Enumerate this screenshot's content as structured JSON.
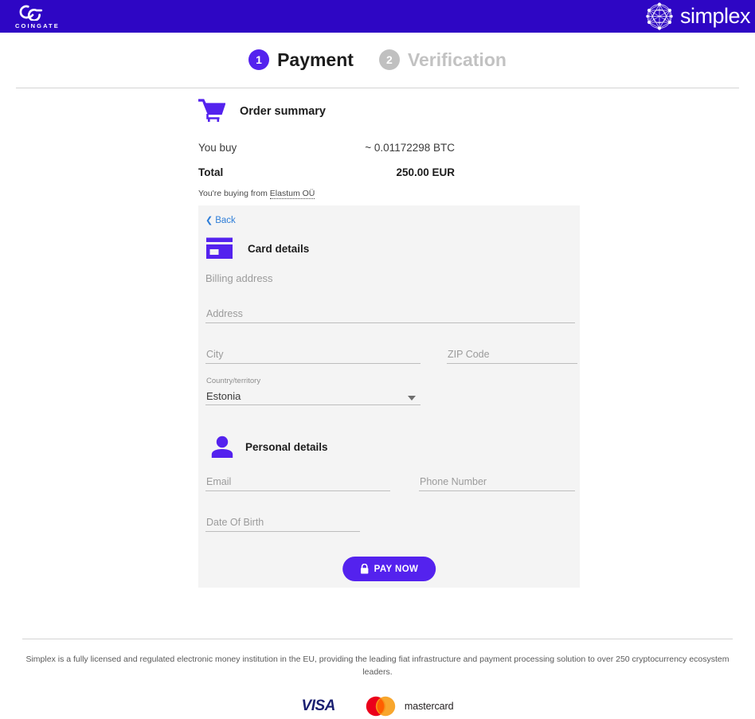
{
  "brand": {
    "coingate_word": "COINGATE",
    "coingate_logo_icon": "coingate-cg-mark",
    "simplex_word": "simplex",
    "simplex_logo_icon": "simplex-network-mark",
    "header_bg": "#2E06C4"
  },
  "steps": [
    {
      "number": "1",
      "label": "Payment",
      "state": "active",
      "color": "#5422EE"
    },
    {
      "number": "2",
      "label": "Verification",
      "state": "inactive",
      "color": "#C0C0C0"
    }
  ],
  "summary": {
    "icon": "shopping-cart-icon",
    "title": "Order summary",
    "rows": [
      {
        "key": "You buy",
        "value": "~ 0.01172298 BTC"
      }
    ],
    "total_key": "Total",
    "total_value": "250.00 EUR",
    "merchant_prefix": "You're buying from ",
    "merchant_name": "Elastum OÜ"
  },
  "panel": {
    "back_label": "Back",
    "back_icon": "chevron-left-icon",
    "card_section": {
      "icon": "credit-card-icon",
      "title": "Card details",
      "billing_label": "Billing address",
      "fields": {
        "address": {
          "placeholder": "Address",
          "value": ""
        },
        "city": {
          "placeholder": "City",
          "value": ""
        },
        "zip": {
          "placeholder": "ZIP Code",
          "value": ""
        },
        "country": {
          "label": "Country/territory",
          "value": "Estonia",
          "icon": "chevron-down-icon"
        }
      }
    },
    "personal_section": {
      "icon": "person-icon",
      "title": "Personal details",
      "fields": {
        "email": {
          "placeholder": "Email",
          "value": ""
        },
        "phone": {
          "placeholder": "Phone Number",
          "value": ""
        },
        "dob": {
          "placeholder": "Date Of Birth",
          "value": ""
        }
      }
    },
    "pay_button": {
      "label": "PAY NOW",
      "icon": "lock-icon",
      "color": "#5422EE"
    },
    "panel_bg": "#F4F4F4"
  },
  "footer": {
    "text": "Simplex is a fully licensed and regulated electronic money institution in the EU, providing the leading fiat infrastructure and payment processing solution to over 250 cryptocurrency ecosystem leaders.",
    "cards": [
      {
        "name": "VISA",
        "icon": "visa-logo",
        "color": "#1A1F71"
      },
      {
        "name": "mastercard",
        "icon": "mastercard-logo",
        "color": "#231F20"
      }
    ]
  }
}
